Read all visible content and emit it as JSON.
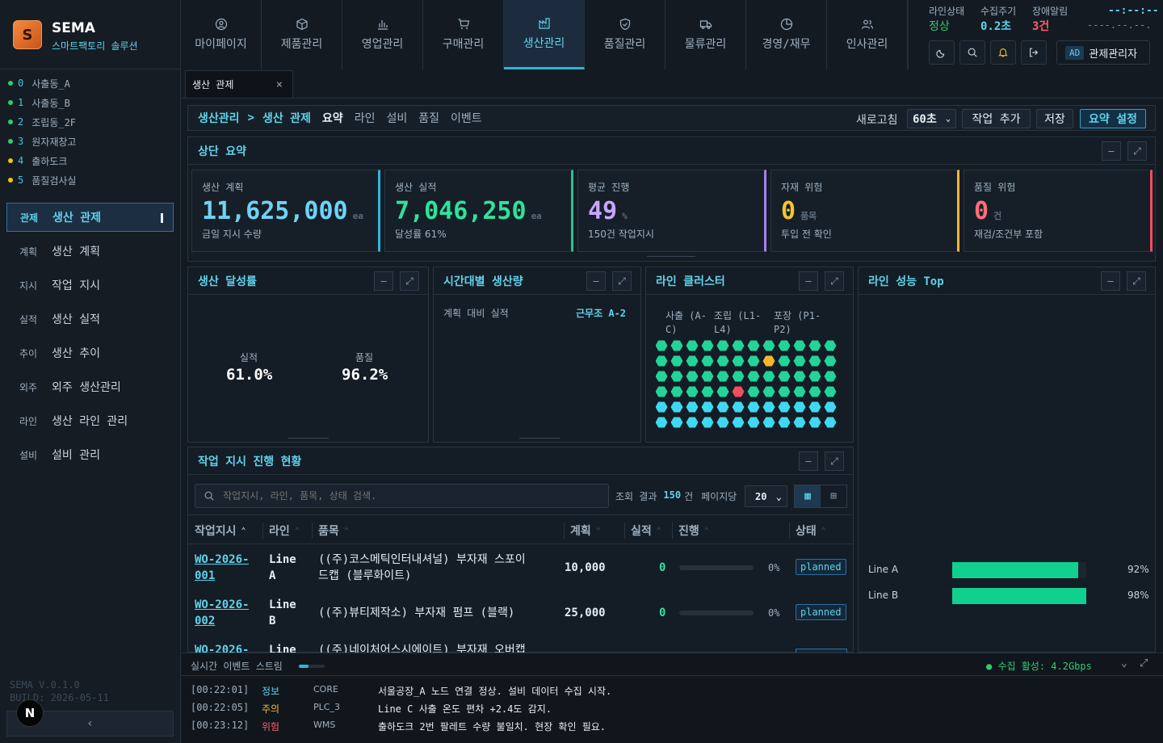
{
  "brand": {
    "logo": "S",
    "name": "SEMA",
    "subtitle": "스마트팩토리 솔루션"
  },
  "sites": [
    {
      "idx": "0",
      "name": "사출동_A",
      "color": "#2ecc71"
    },
    {
      "idx": "1",
      "name": "사출동_B",
      "color": "#2ecc71"
    },
    {
      "idx": "2",
      "name": "조립동_2F",
      "color": "#2ecc71"
    },
    {
      "idx": "3",
      "name": "원자재창고",
      "color": "#2ecc71"
    },
    {
      "idx": "4",
      "name": "출하도크",
      "color": "#f1c40f"
    },
    {
      "idx": "5",
      "name": "품질검사실",
      "color": "#f1c40f"
    }
  ],
  "sidenav": [
    {
      "tag": "관제",
      "label": "생산 관제",
      "active": true
    },
    {
      "tag": "계획",
      "label": "생산 계획"
    },
    {
      "tag": "지시",
      "label": "작업 지시"
    },
    {
      "tag": "실적",
      "label": "생산 실적"
    },
    {
      "tag": "추이",
      "label": "생산 추이"
    },
    {
      "tag": "외주",
      "label": "외주 생산관리"
    },
    {
      "tag": "라인",
      "label": "생산 라인 관리"
    },
    {
      "tag": "설비",
      "label": "설비 관리"
    }
  ],
  "version": {
    "line1": "SEMA V.0.1.0",
    "line2": "BUILD: 2026-05-11"
  },
  "collapse_glyph": "‹",
  "nbadge": "N",
  "topnav": [
    {
      "label": "마이페이지",
      "icon": "user-icon"
    },
    {
      "label": "제품관리",
      "icon": "box-icon"
    },
    {
      "label": "영업관리",
      "icon": "bar-chart-icon"
    },
    {
      "label": "구매관리",
      "icon": "cart-icon"
    },
    {
      "label": "생산관리",
      "icon": "factory-icon",
      "active": true
    },
    {
      "label": "품질관리",
      "icon": "shield-check-icon"
    },
    {
      "label": "물류관리",
      "icon": "truck-icon"
    },
    {
      "label": "경영/재무",
      "icon": "pie-icon"
    },
    {
      "label": "인사관리",
      "icon": "users-icon"
    }
  ],
  "status": {
    "line_label": "라인상태",
    "line_value": "정상",
    "cycle_label": "수집주기",
    "cycle_value": "0.2초",
    "alarm_label": "장애알림",
    "alarm_value": "3건",
    "clock": "--:--:--",
    "date": "----.--.--."
  },
  "admin": {
    "tag": "AD",
    "label": "관제관리자"
  },
  "tab": {
    "label": "생산 관제",
    "close": "×"
  },
  "breadcrumb": {
    "root": "생산관리",
    "sep": ">",
    "current": "생산 관제",
    "items": [
      "요약",
      "라인",
      "설비",
      "품질",
      "이벤트"
    ]
  },
  "toolbar": {
    "refresh_label": "새로고침",
    "refresh_value": "60초",
    "add": "작업 추가",
    "save": "저장",
    "summary": "요약 설정"
  },
  "summary_title": "상단 요약",
  "kpis": [
    {
      "label": "생산 계획",
      "value": "11,625,000",
      "unit": "ea",
      "sub": "금일 지시 수량",
      "color": "#6fd3f5",
      "accent": "#2fb6d8"
    },
    {
      "label": "생산 실적",
      "value": "7,046,250",
      "unit": "ea",
      "sub": "달성률 61%",
      "color": "#2ee39c",
      "accent": "#25c48b"
    },
    {
      "label": "평균 진행",
      "value": "49",
      "unit": "%",
      "sub": "150건 작업지시",
      "color": "#c7a6ff",
      "accent": "#a47ff2"
    },
    {
      "label": "자재 위험",
      "value": "0",
      "unit": "품목",
      "sub": "투입 전 확인",
      "color": "#f4c430",
      "accent": "#f4b62a"
    },
    {
      "label": "품질 위험",
      "value": "0",
      "unit": "건",
      "sub": "재검/조건부 포함",
      "color": "#ff6f7a",
      "accent": "#ef4f5c"
    }
  ],
  "achievement": {
    "title": "생산 달성률",
    "actual_label": "실적",
    "actual_value": "61.0%",
    "quality_label": "품질",
    "quality_value": "96.2%"
  },
  "hourly": {
    "title": "시간대별 생산량",
    "subtitle": "계획 대비 실적",
    "shift": "근무조 A-2"
  },
  "cluster": {
    "title": "라인 클러스터",
    "groups": [
      "사출 (A-C)",
      "조립 (L1-L4)",
      "포장 (P1-P2)"
    ]
  },
  "lineperf": {
    "title": "라인 성능 Top",
    "items": [
      {
        "name": "Line A",
        "value": 92
      },
      {
        "name": "Line B",
        "value": 98
      }
    ]
  },
  "workorders": {
    "title": "작업 지시 진행 현황",
    "search_placeholder": "작업지시, 라인, 품목, 상태 검색.",
    "result_label": "조회 결과",
    "result_count": "150",
    "result_unit": "건",
    "per_page_label": "페이지당",
    "per_page": "20",
    "columns": [
      "작업지시",
      "라인",
      "품목",
      "계획",
      "실적",
      "진행",
      "상태"
    ],
    "rows": [
      {
        "wo": [
          "WO-2026-",
          "001"
        ],
        "line": [
          "Line",
          "A"
        ],
        "item": [
          "((주)코스메틱인터내셔널) 부자재 스포이",
          "드캡 (블루화이트)"
        ],
        "plan": "10,000",
        "actual": "0",
        "progress": 0,
        "progress_label": "0%",
        "status": "planned"
      },
      {
        "wo": [
          "WO-2026-",
          "002"
        ],
        "line": [
          "Line",
          "B"
        ],
        "item": [
          "((주)뷰티제작소) 부자재 펌프 (블랙)",
          ""
        ],
        "plan": "25,000",
        "actual": "0",
        "progress": 0,
        "progress_label": "0%",
        "status": "planned"
      },
      {
        "wo": [
          "WO-2026-",
          ""
        ],
        "line": [
          "Line",
          ""
        ],
        "item": [
          "((주)네이처어스시에이트) 부자재 오버캡",
          ""
        ],
        "plan": "",
        "actual": "",
        "progress": 0,
        "progress_label": "",
        "status": ""
      }
    ]
  },
  "events": {
    "title": "실시간 이벤트 스트림",
    "collect": "● 수집 활성: 4.2Gbps",
    "rows": [
      {
        "time": "[00:22:01]",
        "level": "정보",
        "level_color": "#5fd3ea",
        "src": "CORE",
        "msg": "서울공장_A 노드 연결 정상. 설비 데이터 수집 시작."
      },
      {
        "time": "[00:22:05]",
        "level": "주의",
        "level_color": "#f4c430",
        "src": "PLC_3",
        "msg": "Line C 사출 온도 편차 +2.4도 감지."
      },
      {
        "time": "[00:23:12]",
        "level": "위험",
        "level_color": "#ff5c6a",
        "src": "WMS",
        "msg": "출하도크 2번 팔레트 수량 불일치. 현장 확인 필요."
      }
    ]
  }
}
